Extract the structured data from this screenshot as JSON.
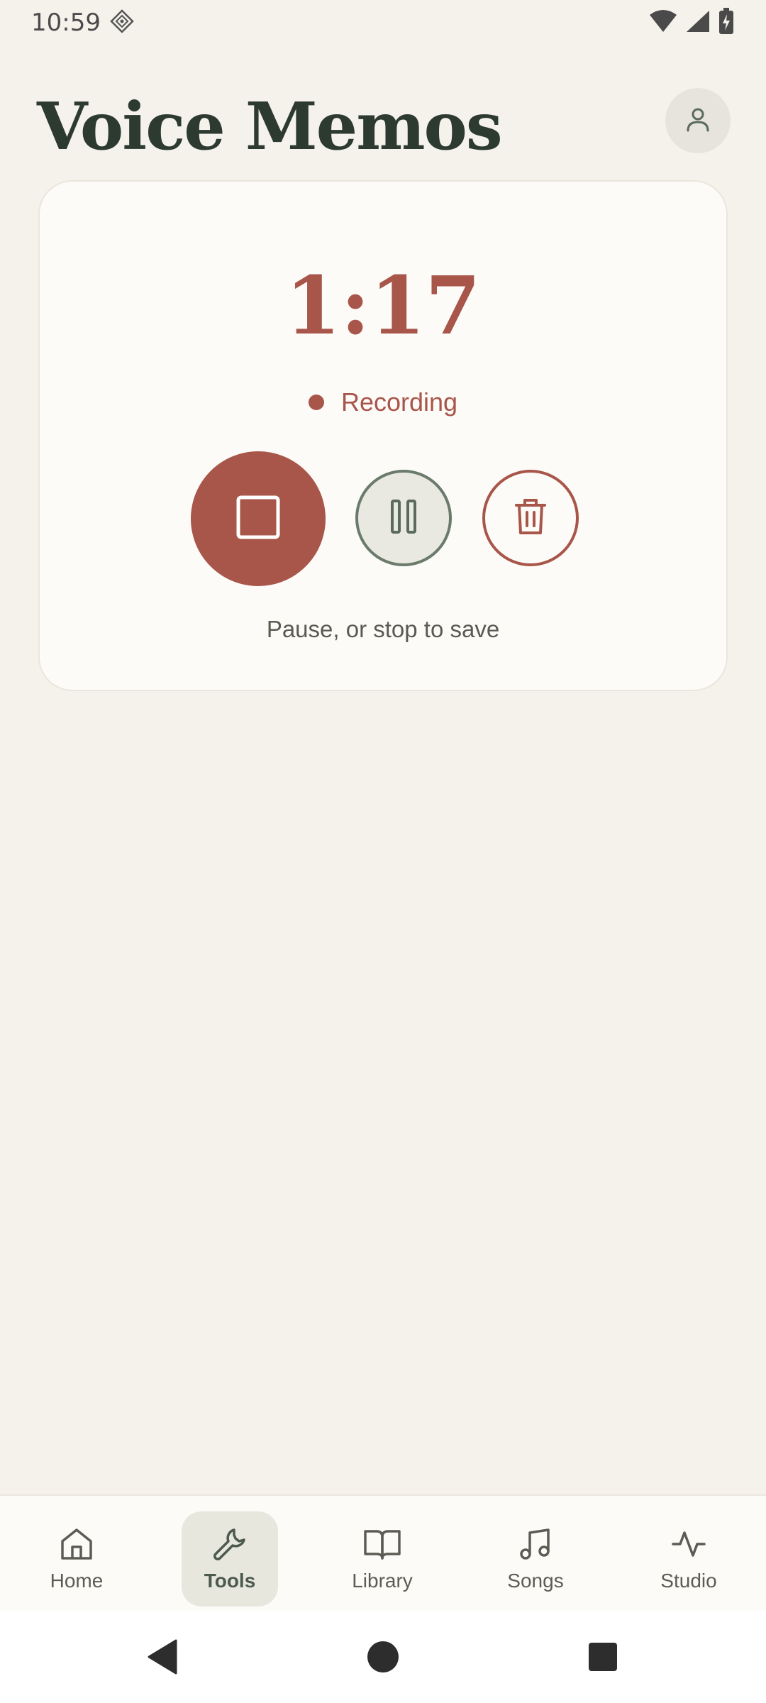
{
  "status_bar": {
    "time": "10:59",
    "icons": [
      "location-diamond-icon",
      "wifi-icon",
      "signal-icon",
      "battery-charging-icon"
    ]
  },
  "header": {
    "title": "Voice Memos",
    "avatar_icon": "person-icon"
  },
  "recorder": {
    "timer": "1:17",
    "status": "Recording",
    "hint": "Pause, or stop to save",
    "buttons": {
      "stop_icon": "stop-icon",
      "pause_icon": "pause-icon",
      "delete_icon": "trash-icon"
    }
  },
  "bottom_nav": {
    "items": [
      {
        "label": "Home",
        "icon": "home-icon",
        "active": false
      },
      {
        "label": "Tools",
        "icon": "wrench-icon",
        "active": true
      },
      {
        "label": "Library",
        "icon": "book-icon",
        "active": false
      },
      {
        "label": "Songs",
        "icon": "music-note-icon",
        "active": false
      },
      {
        "label": "Studio",
        "icon": "activity-icon",
        "active": false
      }
    ]
  },
  "system_nav": {
    "icons": [
      "back-icon",
      "home-circle-icon",
      "recents-icon"
    ]
  },
  "colors": {
    "background": "#f5f2ec",
    "card": "#fdfbf7",
    "accent": "#a8554a",
    "title": "#2c3a2f",
    "pause_border": "#6a7a6b"
  }
}
